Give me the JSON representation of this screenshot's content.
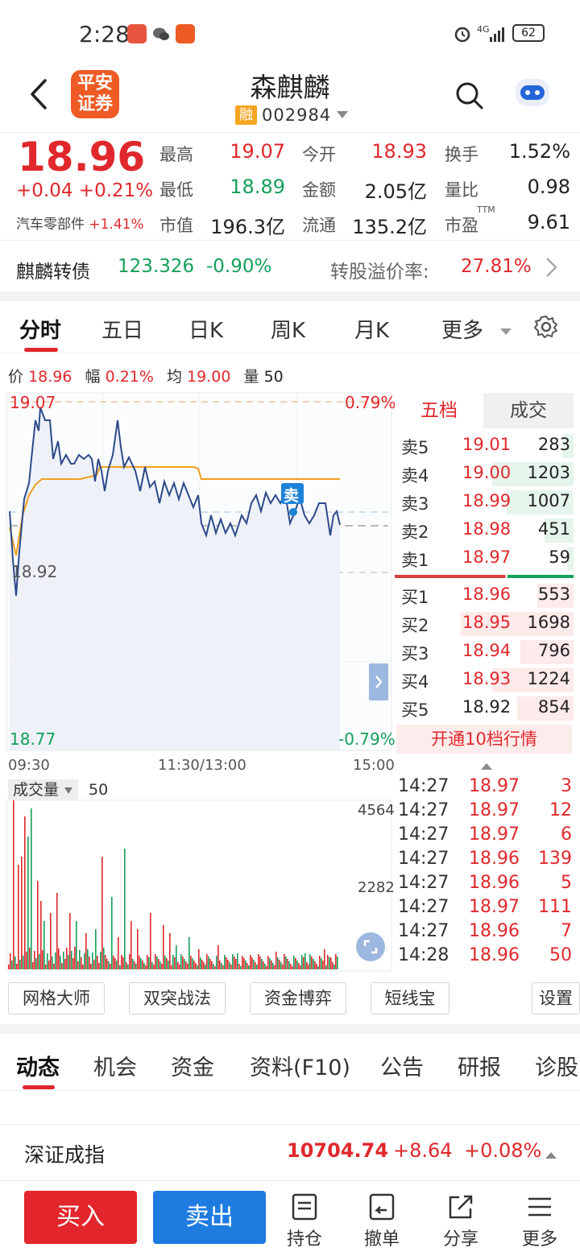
{
  "status_bar": {
    "time": "2:28",
    "battery": "62",
    "network": "4G"
  },
  "header": {
    "stock_name": "森麒麟",
    "margin_badge": "融",
    "stock_code": "002984",
    "broker_logo": "平安\n证券"
  },
  "quote": {
    "price": "18.96",
    "change": "+0.04",
    "change_pct": "+0.21%",
    "industry": "汽车零部件",
    "industry_chg": "+1.41%",
    "items": [
      {
        "label": "最高",
        "value": "19.07",
        "color": "red"
      },
      {
        "label": "今开",
        "value": "18.93",
        "color": "red"
      },
      {
        "label": "换手",
        "value": "1.52%",
        "color": "black"
      },
      {
        "label": "最低",
        "value": "18.89",
        "color": "green"
      },
      {
        "label": "金额",
        "value": "2.05亿",
        "color": "black"
      },
      {
        "label": "量比",
        "value": "0.98",
        "color": "black"
      },
      {
        "label": "市值",
        "value": "196.3亿",
        "color": "black"
      },
      {
        "label": "流通",
        "value": "135.2亿",
        "color": "black"
      },
      {
        "label": "市盈",
        "value": "9.61",
        "color": "black"
      }
    ],
    "pe_superscript": "TTM"
  },
  "bond": {
    "name": "麒麟转债",
    "price": "123.326",
    "chg": "-0.90%",
    "premium_label": "转股溢价率:",
    "premium": "27.81%"
  },
  "chart_tabs": [
    "分时",
    "五日",
    "日K",
    "周K",
    "月K",
    "更多"
  ],
  "chart_info": {
    "price_label": "价",
    "price": "18.96",
    "amp_label": "幅",
    "amp": "0.21%",
    "avg_label": "均",
    "avg": "19.00",
    "vol_label": "量",
    "vol": "50"
  },
  "chart_labels": {
    "high": "19.07",
    "high_pct": "0.79%",
    "mid": "18.92",
    "low": "18.77",
    "low_pct": "-0.79%",
    "sell_marker": "卖",
    "time_start": "09:30",
    "time_mid": "11:30/13:00",
    "time_end": "15:00"
  },
  "volume": {
    "selector": "成交量",
    "value": "50",
    "max": "4564",
    "mid": "2282"
  },
  "book_tabs": [
    "五档",
    "成交"
  ],
  "asks": [
    {
      "label": "卖5",
      "price": "19.01",
      "vol": "283",
      "bar": 0.1
    },
    {
      "label": "卖4",
      "price": "19.00",
      "vol": "1203",
      "bar": 0.72
    },
    {
      "label": "卖3",
      "price": "18.99",
      "vol": "1007",
      "bar": 0.59
    },
    {
      "label": "卖2",
      "price": "18.98",
      "vol": "451",
      "bar": 0.26
    },
    {
      "label": "卖1",
      "price": "18.97",
      "vol": "59",
      "bar": 0.03
    }
  ],
  "bids": [
    {
      "label": "买1",
      "price": "18.96",
      "vol": "553",
      "bar": 0.32
    },
    {
      "label": "买2",
      "price": "18.95",
      "vol": "1698",
      "bar": 1.0
    },
    {
      "label": "买3",
      "price": "18.94",
      "vol": "796",
      "bar": 0.47
    },
    {
      "label": "买4",
      "price": "18.93",
      "vol": "1224",
      "bar": 0.72
    },
    {
      "label": "买5",
      "price": "18.92",
      "vol": "854",
      "bar": 0.5
    }
  ],
  "level10": "开通10档行情",
  "trades": [
    {
      "time": "14:27",
      "price": "18.97",
      "vol": "3"
    },
    {
      "time": "14:27",
      "price": "18.97",
      "vol": "12"
    },
    {
      "time": "14:27",
      "price": "18.97",
      "vol": "6"
    },
    {
      "time": "14:27",
      "price": "18.96",
      "vol": "139"
    },
    {
      "time": "14:27",
      "price": "18.96",
      "vol": "5"
    },
    {
      "time": "14:27",
      "price": "18.97",
      "vol": "111"
    },
    {
      "time": "14:27",
      "price": "18.96",
      "vol": "7"
    },
    {
      "time": "14:28",
      "price": "18.96",
      "vol": "50"
    }
  ],
  "tools": [
    "网格大师",
    "双突战法",
    "资金博弈",
    "短线宝",
    "设置"
  ],
  "news_tabs": [
    "动态",
    "机会",
    "资金",
    "资料(F10)",
    "公告",
    "研报",
    "诊股"
  ],
  "index": {
    "name": "深证成指",
    "value": "10704.74",
    "chg": "+8.64",
    "chg_pct": "+0.08%"
  },
  "bottom": {
    "buy": "买入",
    "sell": "卖出",
    "nav": [
      "持仓",
      "撤单",
      "分享",
      "更多"
    ]
  },
  "colors": {
    "up": "#e0282c",
    "down": "#15a05b",
    "buy_btn": "#e3262b",
    "sell_btn": "#1e7be0",
    "price_line": "#2c4a8a",
    "avg_line": "#f0a020"
  }
}
